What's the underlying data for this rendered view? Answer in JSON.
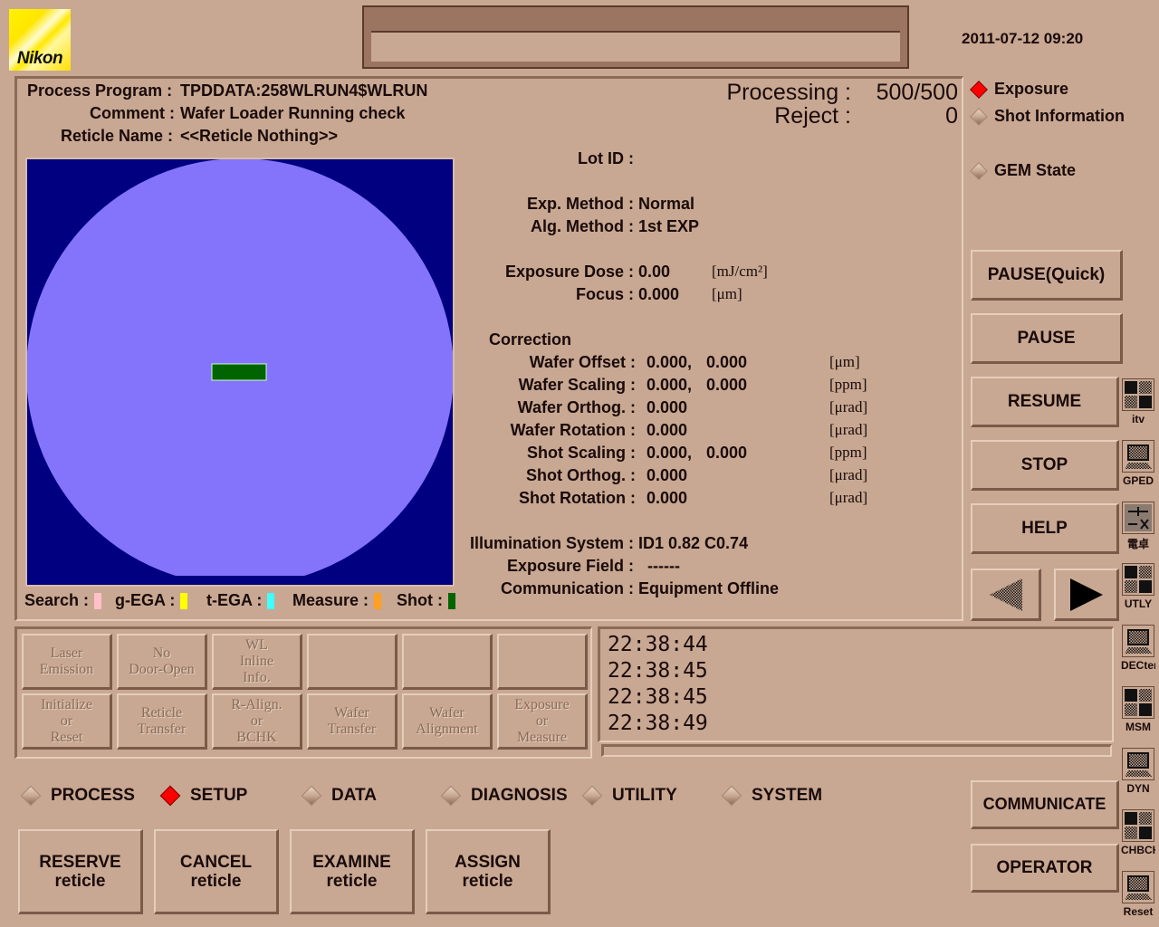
{
  "header": {
    "brand": "Nikon",
    "message_bar_text": "",
    "datetime": "2011-07-12 09:20"
  },
  "process_info": {
    "process_program_label": "Process Program :",
    "process_program_value": "TPDDATA:258WLRUN4$WLRUN",
    "comment_label": "Comment :",
    "comment_value": "Wafer Loader Running check",
    "reticle_name_label": "Reticle Name :",
    "reticle_name_value": "<<Reticle Nothing>>"
  },
  "counters": {
    "processing_label": "Processing :",
    "processing_value": "500/500",
    "reject_label": "Reject :",
    "reject_value": "0"
  },
  "details": {
    "lot_id_label": "Lot ID :",
    "lot_id_value": "",
    "exp_method_label": "Exp. Method :",
    "exp_method_value": "Normal",
    "alg_method_label": "Alg. Method :",
    "alg_method_value": "1st EXP",
    "exposure_dose_label": "Exposure Dose :",
    "exposure_dose_value": "0.00",
    "exposure_dose_unit": "[mJ/cm²]",
    "focus_label": "Focus :",
    "focus_value": "0.000",
    "focus_unit": "[μm]",
    "correction_title": "Correction",
    "corrections": [
      {
        "label": "Wafer Offset :",
        "v1": "0.000,",
        "v2": "0.000",
        "unit": "[μm]"
      },
      {
        "label": "Wafer Scaling :",
        "v1": "0.000,",
        "v2": "0.000",
        "unit": "[ppm]"
      },
      {
        "label": "Wafer Orthog. :",
        "v1": "0.000",
        "v2": "",
        "unit": "[μrad]"
      },
      {
        "label": "Wafer Rotation :",
        "v1": "0.000",
        "v2": "",
        "unit": "[μrad]"
      },
      {
        "label": "Shot Scaling :",
        "v1": "0.000,",
        "v2": "0.000",
        "unit": "[ppm]"
      },
      {
        "label": "Shot Orthog. :",
        "v1": "0.000",
        "v2": "",
        "unit": "[μrad]"
      },
      {
        "label": "Shot Rotation :",
        "v1": "0.000",
        "v2": "",
        "unit": "[μrad]"
      }
    ],
    "illumination_label": "Illumination System :",
    "illumination_value": "ID1 0.82 C0.74",
    "exposure_field_label": "Exposure Field :",
    "exposure_field_value": "------",
    "communication_label": "Communication :",
    "communication_value": "Equipment Offline"
  },
  "wafer_map": {
    "background_color": "#000080",
    "wafer_color": "#8474fc",
    "shot_color": "#006400"
  },
  "legend": [
    {
      "label": "Search :",
      "color": "#ffc0c8"
    },
    {
      "label": "g-EGA :",
      "color": "#ffff00"
    },
    {
      "label": "t-EGA :",
      "color": "#40ffff"
    },
    {
      "label": "Measure :",
      "color": "#ffa020"
    },
    {
      "label": "Shot :",
      "color": "#006400"
    }
  ],
  "view_options": [
    {
      "label": "Exposure",
      "selected": true
    },
    {
      "label": "Shot Information",
      "selected": false
    },
    {
      "label": "GEM State",
      "selected": false
    }
  ],
  "control_buttons": {
    "pause_quick": "PAUSE(Quick)",
    "pause": "PAUSE",
    "resume": "RESUME",
    "stop": "STOP",
    "help": "HELP",
    "prev": "◀",
    "next": "▶",
    "communicate": "COMMUNICATE",
    "operator": "OPERATOR"
  },
  "status_grid": [
    [
      "Laser\nEmission",
      "No\nDoor-Open",
      "WL\nInline\nInfo.",
      "",
      "",
      ""
    ],
    [
      "Initialize\nor\nReset",
      "Reticle\nTransfer",
      "R-Align.\nor\nBCHK",
      "Wafer\nTransfer",
      "Wafer\nAlignment",
      "Exposure\nor\nMeasure"
    ]
  ],
  "log": [
    "22:38:44",
    "22:38:45",
    "22:38:45",
    "22:38:49"
  ],
  "side_tools": [
    {
      "label": "itv",
      "icon": "windows-icon"
    },
    {
      "label": "GPED",
      "icon": "terminal-icon"
    },
    {
      "label": "電卓",
      "icon": "calculator-icon"
    },
    {
      "label": "UTLY",
      "icon": "windows-icon"
    },
    {
      "label": "DECterm",
      "icon": "terminal-icon"
    },
    {
      "label": "MSM",
      "icon": "windows-icon"
    },
    {
      "label": "DYN",
      "icon": "terminal-icon"
    },
    {
      "label": "CHBCH",
      "icon": "windows-icon"
    },
    {
      "label": "Reset",
      "icon": "terminal-icon"
    }
  ],
  "mode_tabs": [
    {
      "label": "PROCESS",
      "selected": false
    },
    {
      "label": "SETUP",
      "selected": true
    },
    {
      "label": "DATA",
      "selected": false
    },
    {
      "label": "DIAGNOSIS",
      "selected": false
    },
    {
      "label": "UTILITY",
      "selected": false
    },
    {
      "label": "SYSTEM",
      "selected": false
    }
  ],
  "action_buttons": [
    {
      "line1": "RESERVE",
      "line2": "reticle"
    },
    {
      "line1": "CANCEL",
      "line2": "reticle"
    },
    {
      "line1": "EXAMINE",
      "line2": "reticle"
    },
    {
      "line1": "ASSIGN",
      "line2": "reticle"
    }
  ]
}
